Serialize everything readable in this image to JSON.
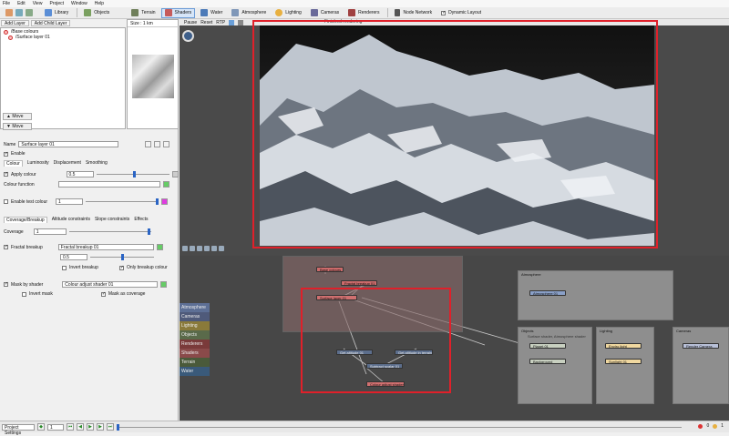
{
  "menu": [
    "File",
    "Edit",
    "View",
    "Project",
    "Window",
    "Help"
  ],
  "toolbar": {
    "items": [
      {
        "label": "Library",
        "color": "#5b8ed6"
      },
      {
        "label": "Objects",
        "color": "#7aa060"
      },
      {
        "label": "Terrain",
        "color": "#6f7f5a"
      },
      {
        "label": "Shaders",
        "color": "#c65b5b",
        "active": true
      },
      {
        "label": "Water",
        "color": "#4d7bb8"
      },
      {
        "label": "Atmosphere",
        "color": "#7f97b8"
      },
      {
        "label": "Lighting",
        "color": "#e8b040"
      },
      {
        "label": "Cameras",
        "color": "#6a6a9a"
      },
      {
        "label": "Renderers",
        "color": "#a04040"
      },
      {
        "label": "Node Network",
        "color": "#555555"
      },
      {
        "label": "Dynamic Layout",
        "color": "#ffffff"
      }
    ]
  },
  "layers": {
    "add_layer": "Add Layer",
    "add_child": "Add Child Layer",
    "items": [
      {
        "label": "/Base colours"
      },
      {
        "label": "/Surface layer 01"
      }
    ],
    "move_up": "Move",
    "move_down": "Move"
  },
  "preview": {
    "size_label": "Size : 1 km"
  },
  "props": {
    "name_label": "Name",
    "name_value": "Surface layer 01",
    "enable_label": "Enable",
    "tabs1": [
      "Colour",
      "Luminosity",
      "Displacement",
      "Smoothing"
    ],
    "apply_colour": "Apply colour",
    "apply_colour_value": "0.5",
    "colour_function": "Colour function",
    "enable_test_colour": "Enable test colour",
    "test_colour_value": "1",
    "tabs2": [
      "Coverage/Breakup",
      "Altitude constraints",
      "Slope constraints",
      "Effects"
    ],
    "coverage_label": "Coverage",
    "coverage_value": "1",
    "fractal_breakup": "Fractal breakup",
    "fractal_breakup_value": "Fractal breakup 01",
    "fractal_small_value": "0.5",
    "invert_breakup": "Invert breakup",
    "only_breakup_colour": "Only breakup colour",
    "mask_by_shader": "Mask by shader",
    "mask_value": "Colour adjust shader 01",
    "invert_mask": "Invert mask",
    "mask_as_coverage": "Mask as coverage"
  },
  "viewport": {
    "pause": "Pause",
    "reset": "Reset",
    "rtp": "RTP",
    "status": "Finished rendering"
  },
  "categories": [
    {
      "label": "Atmosphere",
      "color": "#5d6f95"
    },
    {
      "label": "Cameras",
      "color": "#4f5a7a"
    },
    {
      "label": "Lighting",
      "color": "#8a7a3a"
    },
    {
      "label": "Objects",
      "color": "#5a6a4a"
    },
    {
      "label": "Renderers",
      "color": "#7a3a3a"
    },
    {
      "label": "Shaders",
      "color": "#8a4a4a"
    },
    {
      "label": "Terrain",
      "color": "#4a5a3a"
    },
    {
      "label": "Water",
      "color": "#3a5a7a"
    }
  ],
  "nodes": {
    "base_colours": "Base colours",
    "fractal_breakup": "Fractal breakup 01",
    "surface_layer": "Surface layer 01",
    "get_altitude": "Get altitude 01",
    "get_altitude2": "Get altitude in terrain",
    "subtract": "Subtract scalar 01",
    "colour_adjust": "Colour adjust shader",
    "atmosphere_group": "Atmosphere",
    "atmosphere_node": "Atmosphere 01",
    "objects_group": "Objects",
    "planet": "Planet 01",
    "background": "Background",
    "lighting_group": "Lighting",
    "enviro_light": "Enviro light",
    "sunlight": "Sunlight 01",
    "cameras_group": "Cameras",
    "render_camera": "Render Camera",
    "shader_hint": "Surface shader, Atmosphere shader"
  },
  "bottom": {
    "project_settings": "Project Settings",
    "frame_value": "1",
    "errors": "0",
    "warnings": "1"
  }
}
